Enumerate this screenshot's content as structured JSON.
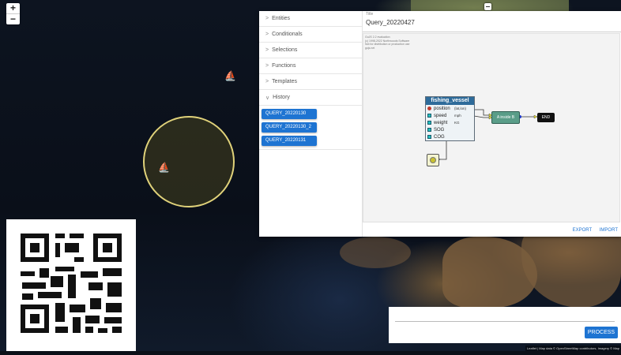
{
  "map": {
    "zoom_in": "+",
    "zoom_out": "−",
    "attribution": "Leaflet | Map data © OpenStreetMap contributors, Imagery © Map"
  },
  "sidebar": {
    "items": [
      {
        "label": "Entities"
      },
      {
        "label": "Conditionals"
      },
      {
        "label": "Selections"
      },
      {
        "label": "Functions"
      },
      {
        "label": "Templates"
      }
    ],
    "history": {
      "label": "History",
      "queries": [
        "QUERY_20220130",
        "QUERY_20220130_2",
        "QUERY_20220131"
      ]
    }
  },
  "editor": {
    "title_label": "Title",
    "title_value": "Query_20220427",
    "notice_lines": [
      "GoJS 2.2 evaluation",
      "(c) 1998-2022 Northwoods Software",
      "Not for distribution or production use",
      "gojs.net"
    ],
    "node": {
      "title": "fishing_vessel",
      "fields": [
        {
          "name": "position",
          "unit": "(lat,lon)",
          "kind": "red"
        },
        {
          "name": "speed",
          "unit": "mph",
          "kind": "teal"
        },
        {
          "name": "weight",
          "unit": "KG",
          "kind": "teal"
        },
        {
          "name": "SOG",
          "unit": "",
          "kind": "teal"
        },
        {
          "name": "COG",
          "unit": "",
          "kind": "teal"
        }
      ]
    },
    "inside_label": "A inside B",
    "end_label": "END",
    "export_label": "EXPORT",
    "import_label": "IMPORT"
  },
  "process_label": "PROCESS",
  "colors": {
    "accent": "#1e74d2",
    "node_header": "#2e6b9a",
    "circle": "#e0d27a"
  }
}
